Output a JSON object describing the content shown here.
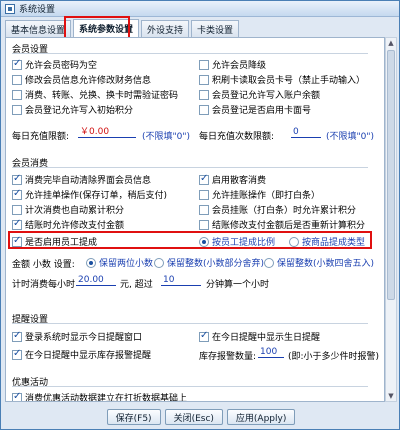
{
  "window": {
    "title": "系统设置"
  },
  "tabs": [
    "基本信息设置",
    "系统参数设置",
    "外设支持",
    "卡类设置"
  ],
  "member_settings": {
    "title": "会员设置",
    "options": [
      {
        "label": "允许会员密码为空",
        "checked": true
      },
      {
        "label": "允许会员降级",
        "checked": false
      },
      {
        "label": "修改会员信息允许修改财务信息",
        "checked": false
      },
      {
        "label": "积刷卡读取会员卡号（禁止手动输入）",
        "checked": false
      },
      {
        "label": "消费、转账、兑换、换卡时需验证密码",
        "checked": false
      },
      {
        "label": "会员登记允许写入账户余额",
        "checked": false
      },
      {
        "label": "会员登记允许写入初始积分",
        "checked": false
      },
      {
        "label": "会员登记是否启用卡面号",
        "checked": false
      }
    ],
    "daily_limit_label": "每日充值限额:",
    "daily_limit_value": "￥0.00",
    "daily_limit_hint": "(不限填\"0\")",
    "daily_count_label": "每日充值次数限额:",
    "daily_count_value": "0",
    "daily_count_hint": "(不限填\"0\")"
  },
  "member_consumption": {
    "title": "会员消费",
    "options": [
      {
        "label": "消费完毕自动清除界面会员信息",
        "checked": true
      },
      {
        "label": "启用散客消费",
        "checked": true
      },
      {
        "label": "允许挂单操作(保存订单，稍后支付)",
        "checked": true
      },
      {
        "label": "允许挂账操作（即打白条）",
        "checked": false
      },
      {
        "label": "计次消费也自动累计积分",
        "checked": false
      },
      {
        "label": "会员挂账（打白条）时允许累计积分",
        "checked": false
      },
      {
        "label": "结账时允许修改支付金额",
        "checked": true
      },
      {
        "label": "结账修改支付金额后是否重新计算积分",
        "checked": false
      }
    ],
    "staff_commission": {
      "label": "是否启用员工提成",
      "checked": true
    },
    "commission_modes": [
      {
        "label": "按员工提成比例",
        "checked": true
      },
      {
        "label": "按商品提成类型",
        "checked": false
      }
    ],
    "amount_decimal_label": "金额  小数  设置:",
    "decimal_modes": [
      {
        "label": "保留两位小数",
        "checked": true
      },
      {
        "label": "保留整数(小数部分舍弃)",
        "checked": false
      },
      {
        "label": "保留整数(小数四舍五入)",
        "checked": false
      }
    ],
    "timing_prefix": "计时消费每小时",
    "timing_price": "20.00",
    "timing_mid": "元, 超过",
    "timing_minutes": "10",
    "timing_suffix": "分钟算一个小时"
  },
  "reminder": {
    "title": "提醒设置",
    "options": [
      {
        "label": "登录系统时显示今日提醒窗口",
        "checked": true
      },
      {
        "label": "在今日提醒中显示生日提醒",
        "checked": true
      },
      {
        "label": "在今日提醒中显示库存报警提醒",
        "checked": true
      }
    ],
    "stock_alarm_label": "库存报警数量:",
    "stock_alarm_value": "100",
    "stock_alarm_hint": "(即:小于多少件时报警)"
  },
  "promotion": {
    "title": "优惠活动",
    "options": [
      {
        "label": "消费优惠活动数据建立在打折数据基础上",
        "checked": true
      }
    ]
  },
  "buttons": {
    "save": "保存(F5)",
    "close": "关闭(Esc)",
    "apply": "应用(Apply)"
  }
}
